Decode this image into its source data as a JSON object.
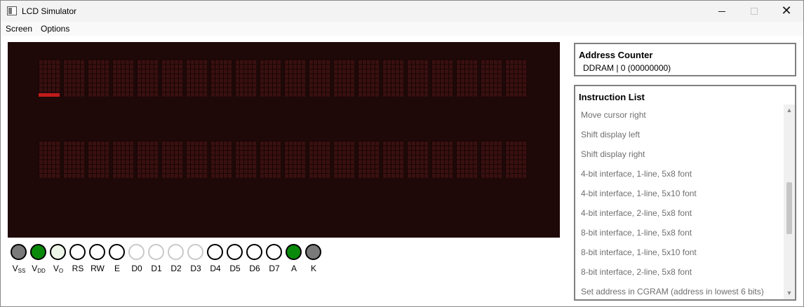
{
  "window": {
    "title": "LCD Simulator",
    "icon": "lcd-app-icon",
    "controls": {
      "minimize": "minimize",
      "maximize": "maximize",
      "close": "close"
    }
  },
  "menu": {
    "screen": "Screen",
    "options": "Options"
  },
  "lcd": {
    "rows": 2,
    "columns": 20,
    "cursor": {
      "row": 1,
      "column": 1
    },
    "colors": {
      "background": "#1e0808",
      "pixel_off": "#3a1010",
      "cursor": "#c21a1a"
    }
  },
  "pins": [
    {
      "name": "V",
      "sub": "SS",
      "state": "gray",
      "color": "#7a7a7a"
    },
    {
      "name": "V",
      "sub": "DD",
      "state": "green",
      "color": "#0a8a0a"
    },
    {
      "name": "V",
      "sub": "O",
      "state": "pale",
      "color": "#eef6ea"
    },
    {
      "name": "RS",
      "sub": "",
      "state": "off",
      "color": "#ffffff"
    },
    {
      "name": "RW",
      "sub": "",
      "state": "off",
      "color": "#ffffff"
    },
    {
      "name": "E",
      "sub": "",
      "state": "off",
      "color": "#ffffff"
    },
    {
      "name": "D0",
      "sub": "",
      "state": "dim",
      "color": "#ffffff"
    },
    {
      "name": "D1",
      "sub": "",
      "state": "dim",
      "color": "#ffffff"
    },
    {
      "name": "D2",
      "sub": "",
      "state": "dim",
      "color": "#ffffff"
    },
    {
      "name": "D3",
      "sub": "",
      "state": "dim",
      "color": "#ffffff"
    },
    {
      "name": "D4",
      "sub": "",
      "state": "off",
      "color": "#ffffff"
    },
    {
      "name": "D5",
      "sub": "",
      "state": "off",
      "color": "#ffffff"
    },
    {
      "name": "D6",
      "sub": "",
      "state": "off",
      "color": "#ffffff"
    },
    {
      "name": "D7",
      "sub": "",
      "state": "off",
      "color": "#ffffff"
    },
    {
      "name": "A",
      "sub": "",
      "state": "green",
      "color": "#0a8a0a"
    },
    {
      "name": "K",
      "sub": "",
      "state": "gray",
      "color": "#7a7a7a"
    }
  ],
  "address_counter": {
    "title": "Address Counter",
    "value": "DDRAM | 0 (00000000)"
  },
  "instruction_list": {
    "title": "Instruction List",
    "items": [
      "Move cursor right",
      "Shift display left",
      "Shift display right",
      "4-bit interface, 1-line, 5x8 font",
      "4-bit interface, 1-line, 5x10 font",
      "4-bit interface, 2-line, 5x8 font",
      "8-bit interface, 1-line, 5x8 font",
      "8-bit interface, 1-line, 5x10 font",
      "8-bit interface, 2-line, 5x8 font",
      "Set address in CGRAM (address in lowest 6 bits)"
    ],
    "scroll_position": 0.55
  }
}
